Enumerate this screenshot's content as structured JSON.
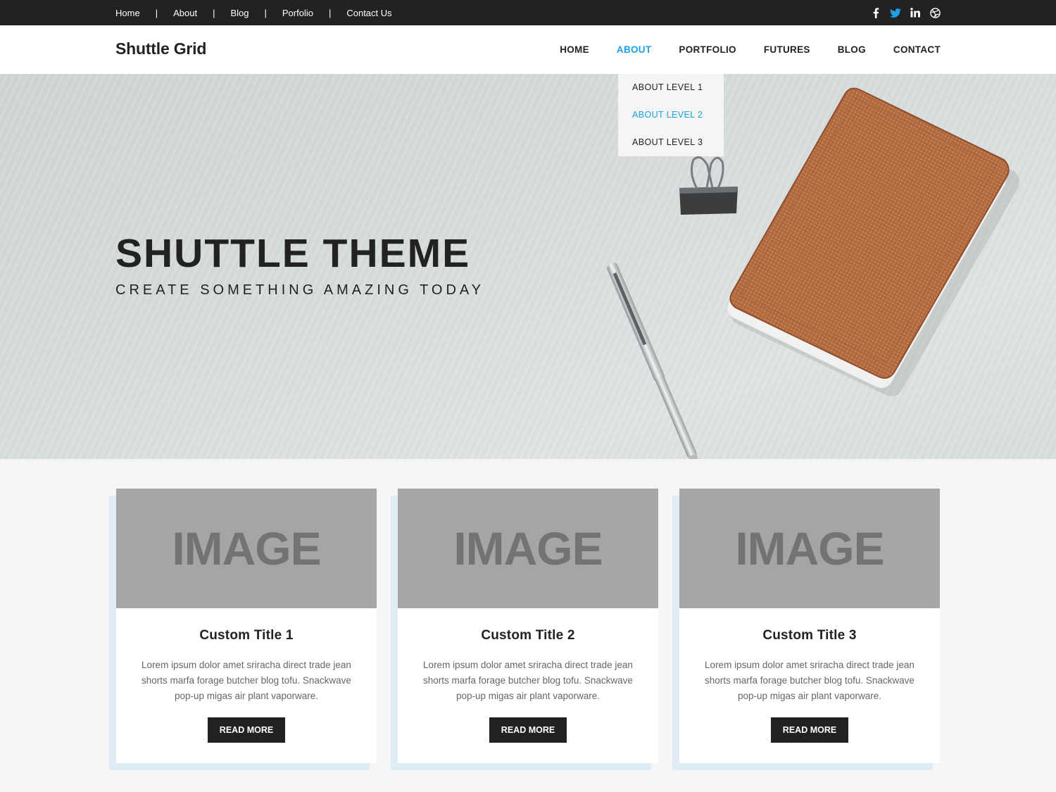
{
  "topbar": {
    "links": [
      "Home",
      "About",
      "Blog",
      "Porfolio",
      "Contact Us"
    ],
    "separator": "|",
    "social_icons": [
      "facebook-icon",
      "twitter-icon",
      "linkedin-icon",
      "dribbble-icon"
    ]
  },
  "header": {
    "logo": "Shuttle Grid",
    "nav": [
      "HOME",
      "ABOUT",
      "PORTFOLIO",
      "FUTURES",
      "BLOG",
      "CONTACT"
    ],
    "active_nav": "ABOUT"
  },
  "dropdown": {
    "items": [
      "ABOUT LEVEL 1",
      "ABOUT LEVEL 2",
      "ABOUT LEVEL 3"
    ],
    "active_item": "ABOUT LEVEL 2"
  },
  "hero": {
    "title": "SHUTTLE THEME",
    "subtitle": "CREATE SOMETHING AMAZING TODAY"
  },
  "cards": [
    {
      "image_label": "IMAGE",
      "title": "Custom Title 1",
      "text": "Lorem ipsum dolor amet sriracha direct trade jean shorts marfa forage butcher blog tofu. Snackwave pop-up migas air plant vaporware.",
      "button": "READ MORE"
    },
    {
      "image_label": "IMAGE",
      "title": "Custom Title 2",
      "text": "Lorem ipsum dolor amet sriracha direct trade jean shorts marfa forage butcher blog tofu. Snackwave pop-up migas air plant vaporware.",
      "button": "READ MORE"
    },
    {
      "image_label": "IMAGE",
      "title": "Custom Title 3",
      "text": "Lorem ipsum dolor amet sriracha direct trade jean shorts marfa forage butcher blog tofu. Snackwave pop-up migas air plant vaporware.",
      "button": "READ MORE"
    }
  ],
  "colors": {
    "accent": "#1ba1e2",
    "topbar_bg": "#222222",
    "button_bg": "#222222",
    "image_placeholder": "#a5a5a5",
    "card_shadow": "#ddecf5"
  }
}
